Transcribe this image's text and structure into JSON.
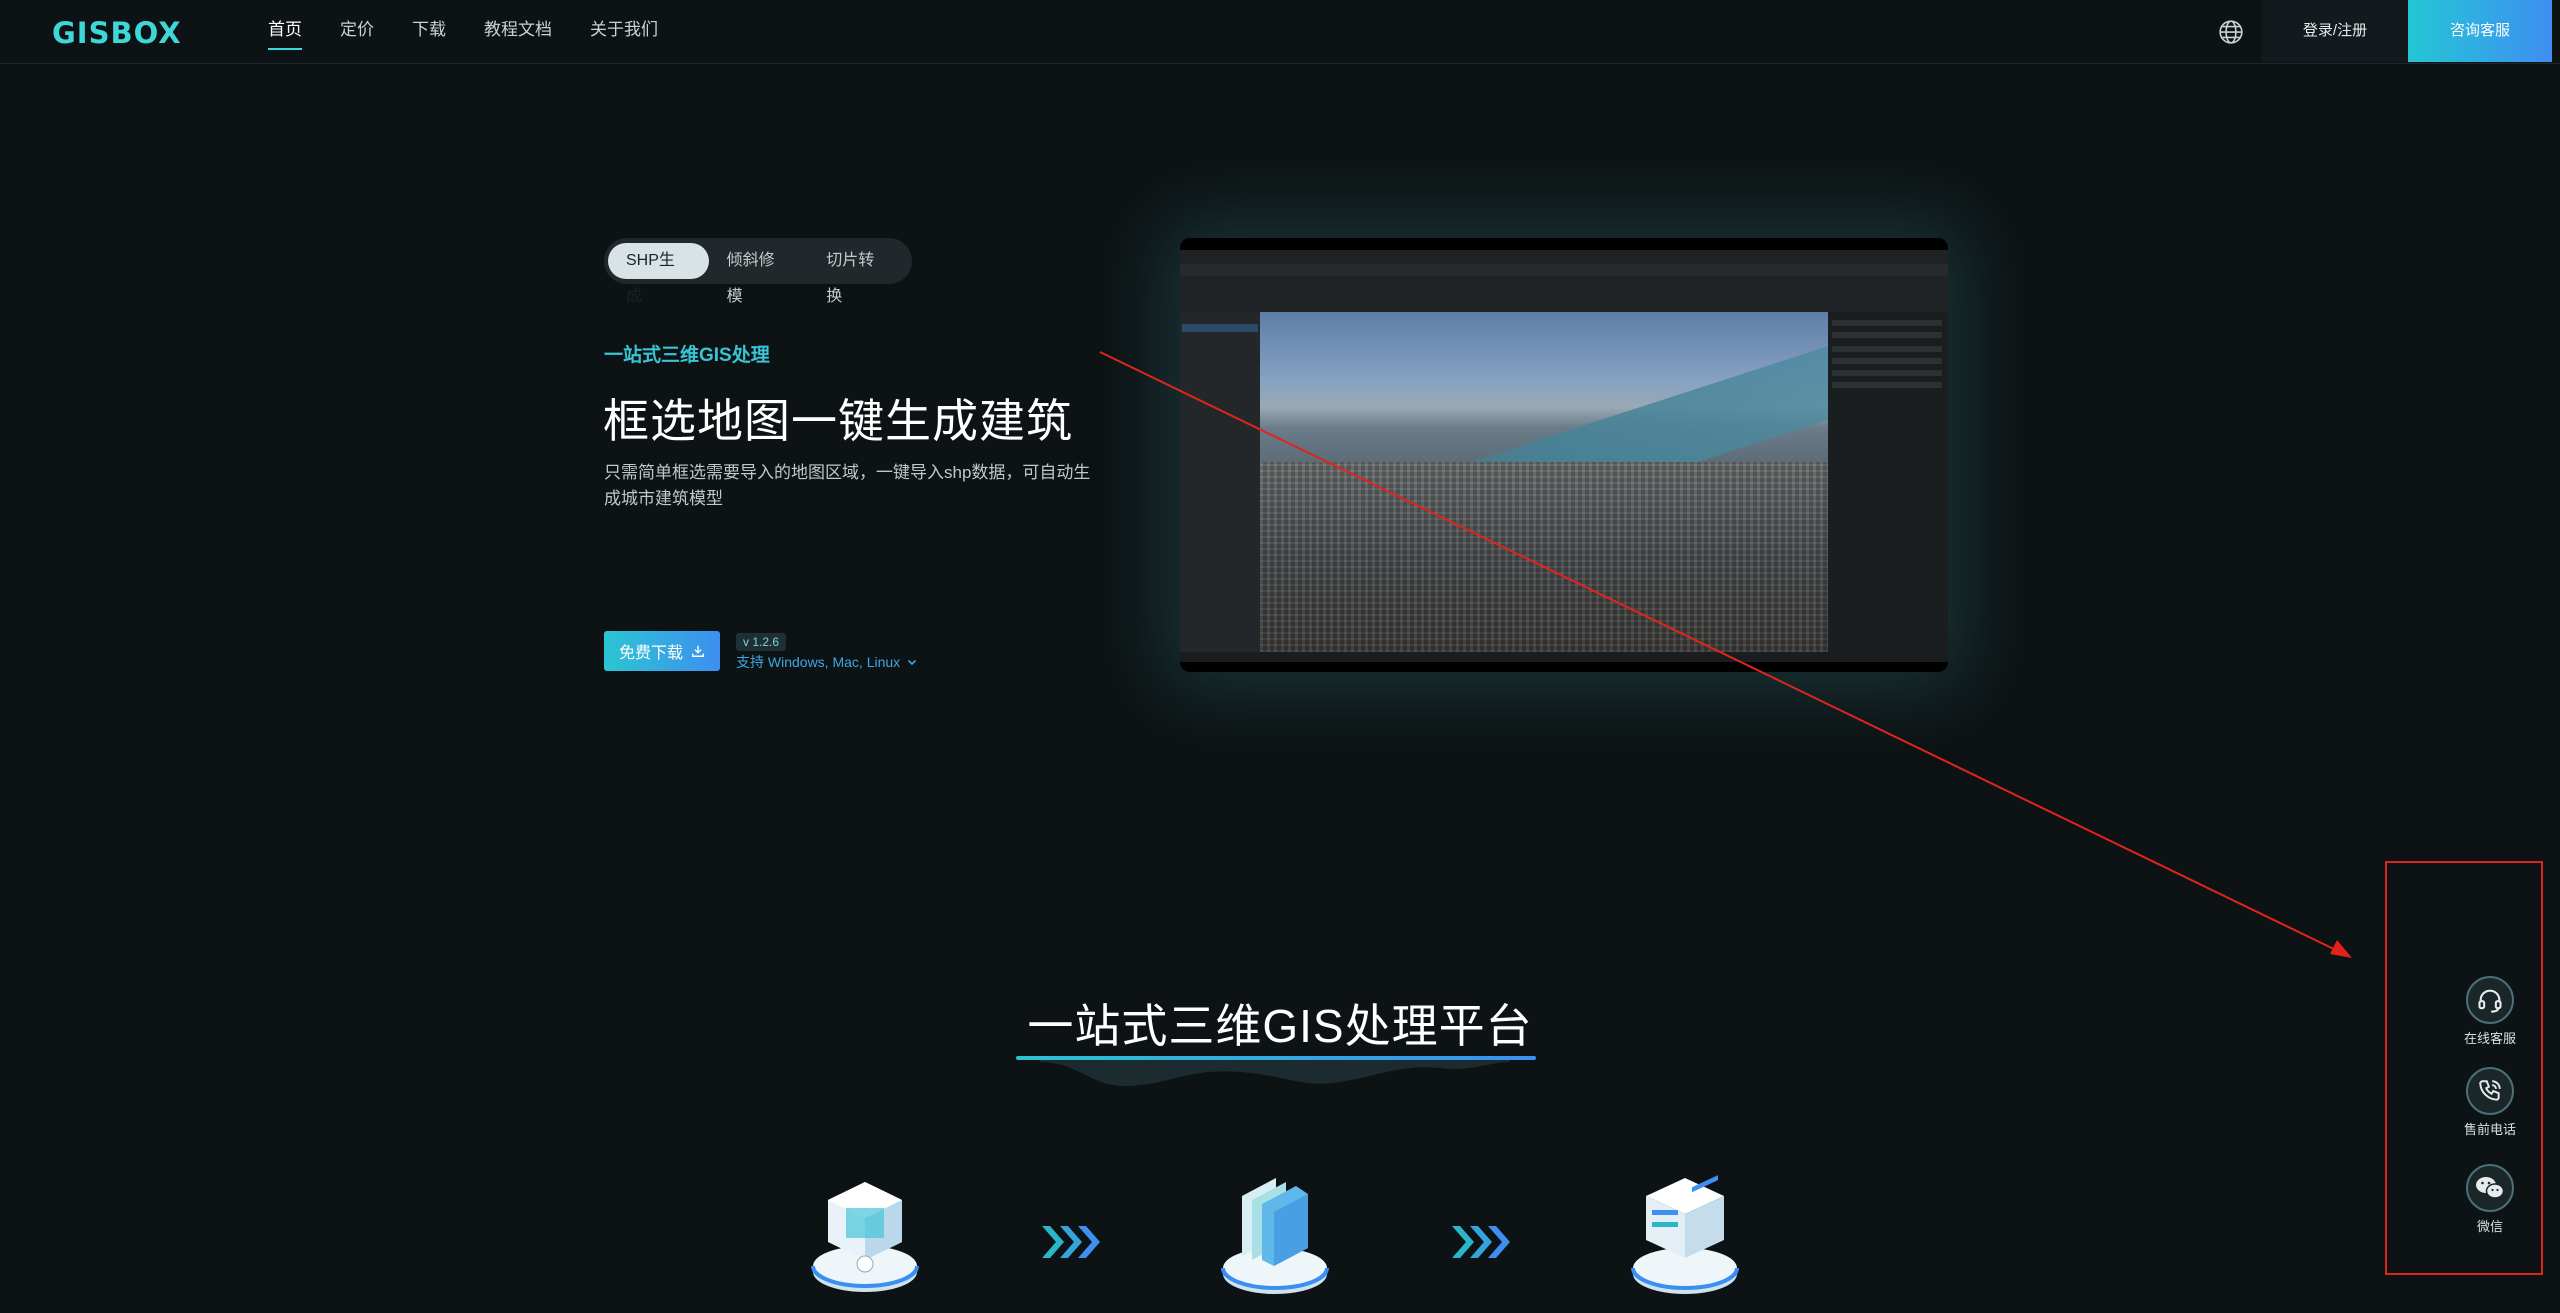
{
  "header": {
    "logo": "GISBOX",
    "nav": [
      "首页",
      "定价",
      "下载",
      "教程文档",
      "关于我们"
    ],
    "active_nav": "首页",
    "login_label": "登录/注册",
    "consult_label": "咨询客服"
  },
  "hero": {
    "tabs": [
      "SHP生成",
      "倾斜修模",
      "切片转换"
    ],
    "active_tab": "SHP生成",
    "subtitle": "一站式三维GIS处理",
    "headline": "框选地图一键生成建筑",
    "description": "只需简单框选需要导入的地图区域，一键导入shp数据，可自动生成城市建筑模型",
    "download_label": "免费下载",
    "version": "v 1.2.6",
    "platforms": "支持 Windows, Mac, Linux"
  },
  "float_bar": {
    "items": [
      {
        "label": "在线客服",
        "icon": "headset-icon"
      },
      {
        "label": "售前电话",
        "icon": "phone-icon"
      },
      {
        "label": "微信",
        "icon": "wechat-icon"
      }
    ]
  },
  "section": {
    "title": "一站式三维GIS处理平台"
  },
  "colors": {
    "background": "#0d1214",
    "accent": "#3fd6d8",
    "accent_blue": "#3d8ff0",
    "annotation": "#e0241c"
  }
}
